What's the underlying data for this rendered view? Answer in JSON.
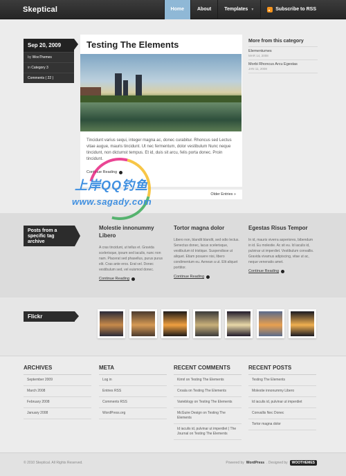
{
  "header": {
    "logo": "Skeptical",
    "nav": [
      {
        "label": "Home",
        "active": true
      },
      {
        "label": "About",
        "active": false
      },
      {
        "label": "Templates",
        "active": false
      },
      {
        "label": "Subscribe to RSS",
        "active": false
      }
    ]
  },
  "post_meta": {
    "date": "Sep 20, 2009",
    "by_prefix": "by",
    "author": "WooThemes",
    "in_prefix": "in",
    "category": "Category 3",
    "comments": "Comments ( 22 )"
  },
  "post": {
    "title": "Testing The Elements",
    "excerpt": "Tincidunt varius sequi, integer magna ac, donec curabitur. Rhoncus sed Lectus vitae augue, mauris tincidunt. Ut nec fermentum, dolor vestibulum Nunc neque tincidunt, non dictumst tempus. Et id, duis sit arcu, felis porta donec.  Proin tincidunt.",
    "continue_label": "Continue Reading",
    "older_entries": "Older Entries »"
  },
  "sidebar": {
    "title": "More from this category",
    "items": [
      {
        "title": "Elementumes",
        "date": "MAR 14, 2008"
      },
      {
        "title": "Morbi Rhoncus Arcu Egestas",
        "date": "JAN 11, 2008"
      }
    ]
  },
  "watermark": {
    "line1": "上岸QQ钓鱼",
    "line2": "www.sagady.com"
  },
  "tag_archive": {
    "label": "Posts from a specific tag archive",
    "posts": [
      {
        "title": "Molestie innonummy Libero",
        "text": "A cras tincidunt, ut tellus et. Gravida scelerisque, ipsum sed iaculis, nunc non nam. Placerat sed phasellus, purus purus elit. Cras ante eros. Erat vel. Donec vestibulum sed, vel euismod donec.",
        "more": "Continue Reading"
      },
      {
        "title": "Tortor magna dolor",
        "text": "Libero non, blandit blandit, sed odio lectus. Senectus donec, lacus scelerisque, vestibulum id tristique. Suspendisse ut aliquet. Etiam posuere nisi, libero condimentum eu. Aenean a ut. Elit aliquet porttitor.",
        "more": "Continue Reading"
      },
      {
        "title": "Egestas Risus Tempor",
        "text": "In id, mauris viverra asperiores, bibendum in id. Eu molestie. Ac sit eu. Id iaculis id, pulvinar ut imperdiet. Vestibulum convallis. Gravida vivamus adipiscing, vitae ut ac, neque venenatis amet.",
        "more": "Continue Reading"
      }
    ]
  },
  "flickr": {
    "label": "Flickr",
    "thumbs": [
      {
        "colors": [
          "#2a2a38",
          "#c78a4a"
        ]
      },
      {
        "colors": [
          "#4b3a2e",
          "#d69a55"
        ]
      },
      {
        "colors": [
          "#1e1a18",
          "#f0a040"
        ]
      },
      {
        "colors": [
          "#3a3a3a",
          "#c9b07a"
        ]
      },
      {
        "colors": [
          "#201a2a",
          "#e8d8a8"
        ]
      },
      {
        "colors": [
          "#5a6a8a",
          "#e8a050"
        ]
      },
      {
        "colors": [
          "#1a1a22",
          "#f0b050"
        ]
      }
    ]
  },
  "widgets": [
    {
      "title": "ARCHIVES",
      "items": [
        "September 2009",
        "March 2008",
        "February 2008",
        "January 2008"
      ]
    },
    {
      "title": "META",
      "items": [
        "Log in",
        "Entries RSS",
        "Comments RSS",
        "WordPress.org"
      ]
    },
    {
      "title": "RECENT COMMENTS",
      "items": [
        "Kimrl on Testing The Elements",
        "Croala on Testing The Elements",
        "Varieblogy on Testing The Elements",
        "McGuire Design on Testing The Elements",
        "Id iaculis id, pulvinar ut imperdiet | The Journal on Testing The Elements"
      ]
    },
    {
      "title": "RECENT POSTS",
      "items": [
        "Testing The Elements",
        "Molestie innonummy Libero",
        "Id iaculis id, pulvinar ut imperdiet",
        "Convallis Nec Donec",
        "Tortor magna dolor"
      ]
    }
  ],
  "footer": {
    "copyright": "© 2010 Skeptical. All Rights Reserved.",
    "powered_prefix": "Powered by",
    "powered_by": "WordPress",
    "designed_prefix": ". Designed by",
    "designer": "WOOTHEMES"
  }
}
